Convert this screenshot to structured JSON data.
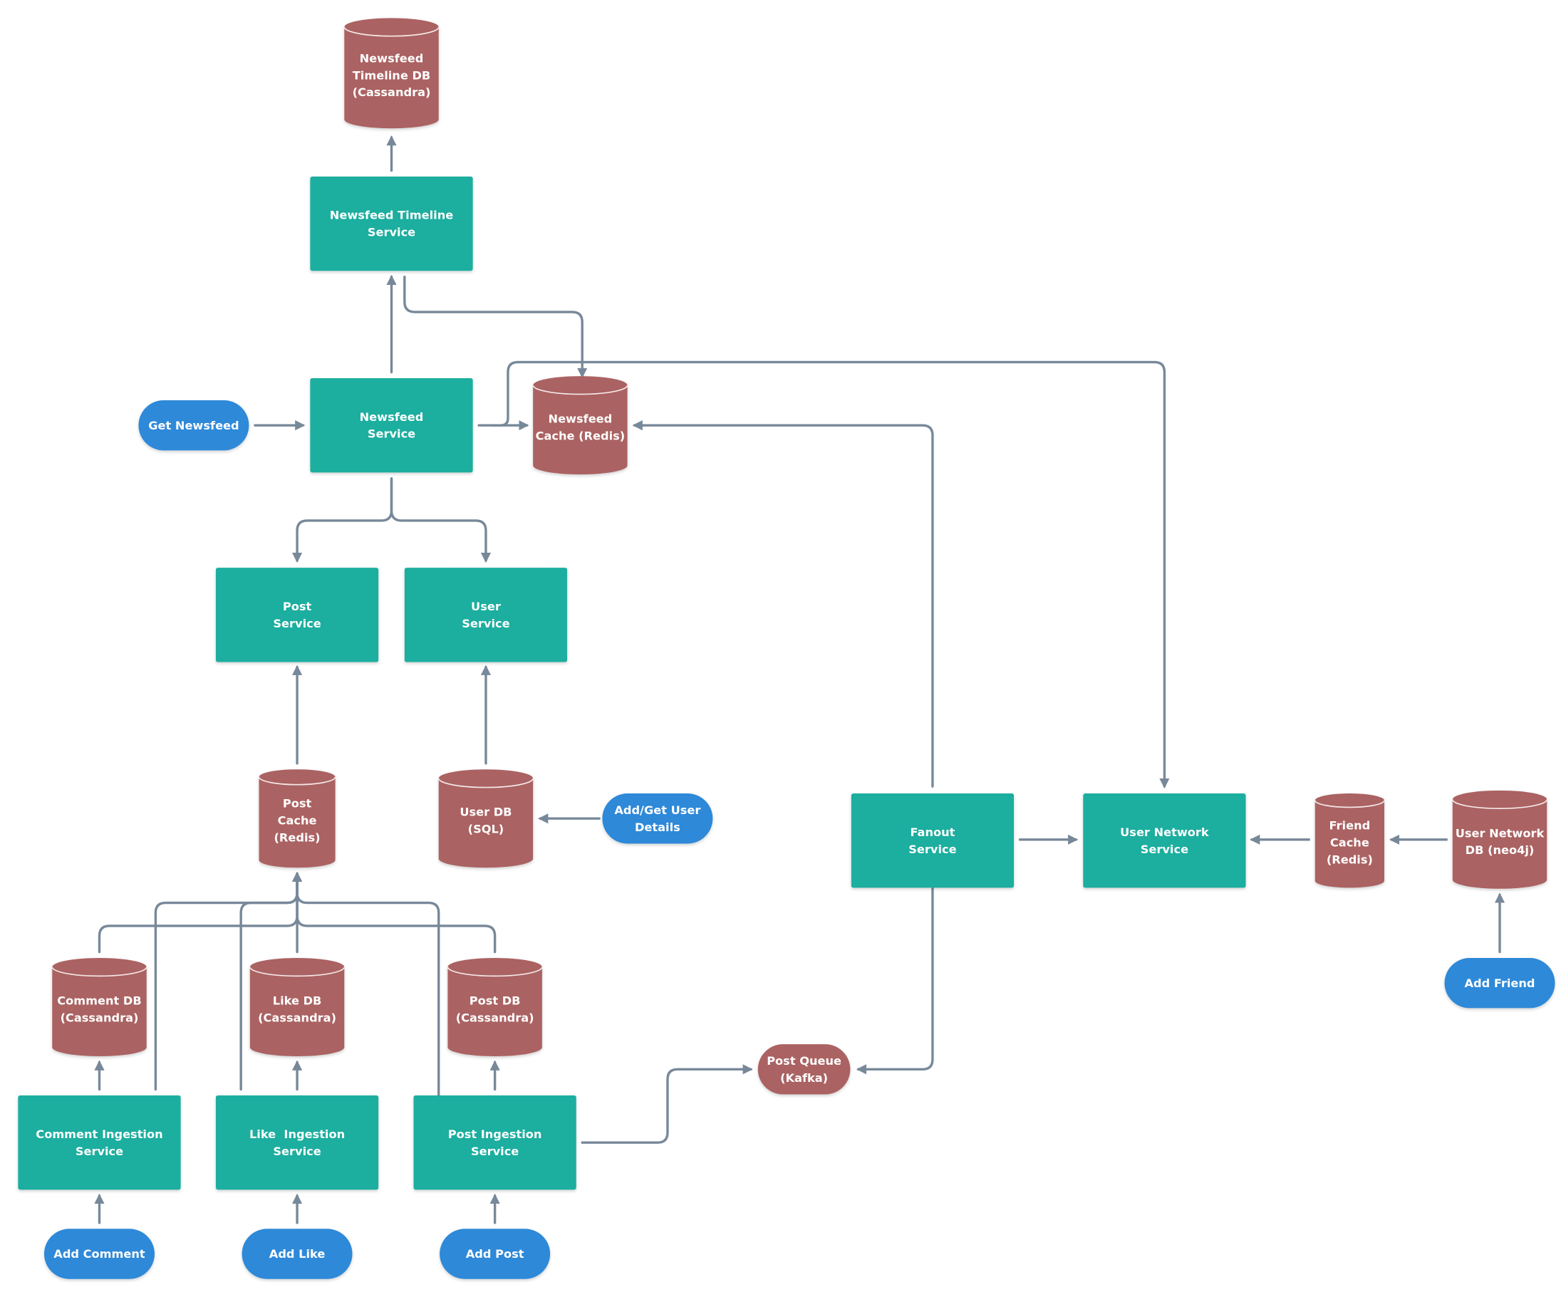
{
  "diagram": {
    "colors": {
      "service": "#1bae9f",
      "datastore": "#ab6262",
      "action": "#2d89d8",
      "connector": "#778899",
      "text": "#ffffff"
    },
    "nodes": {
      "timeline_db": {
        "kind": "database",
        "lines": [
          "Newsfeed",
          "Timeline DB",
          "(Cassandra)"
        ]
      },
      "timeline_service": {
        "kind": "service",
        "lines": [
          "Newsfeed Timeline",
          "Service"
        ]
      },
      "get_newsfeed": {
        "kind": "action",
        "lines": [
          "Get Newsfeed"
        ]
      },
      "newsfeed_service": {
        "kind": "service",
        "lines": [
          "Newsfeed",
          "Service"
        ]
      },
      "newsfeed_cache": {
        "kind": "database",
        "lines": [
          "Newsfeed",
          "Cache (Redis)"
        ]
      },
      "post_service": {
        "kind": "service",
        "lines": [
          "Post",
          "Service"
        ]
      },
      "user_service": {
        "kind": "service",
        "lines": [
          "User",
          "Service"
        ]
      },
      "post_cache": {
        "kind": "database",
        "lines": [
          "Post",
          "Cache",
          "(Redis)"
        ]
      },
      "user_db": {
        "kind": "database",
        "lines": [
          "User DB",
          "(SQL)"
        ]
      },
      "add_get_user": {
        "kind": "action",
        "lines": [
          "Add/Get User",
          "Details"
        ]
      },
      "comment_db": {
        "kind": "database",
        "lines": [
          "Comment DB",
          "(Cassandra)"
        ]
      },
      "like_db": {
        "kind": "database",
        "lines": [
          "Like DB",
          "(Cassandra)"
        ]
      },
      "post_db": {
        "kind": "database",
        "lines": [
          "Post DB",
          "(Cassandra)"
        ]
      },
      "comment_ingestion": {
        "kind": "service",
        "lines": [
          "Comment Ingestion",
          "Service"
        ]
      },
      "like_ingestion": {
        "kind": "service",
        "lines": [
          "Like  Ingestion",
          "Service"
        ]
      },
      "post_ingestion": {
        "kind": "service",
        "lines": [
          "Post Ingestion",
          "Service"
        ]
      },
      "add_comment": {
        "kind": "action",
        "lines": [
          "Add Comment"
        ]
      },
      "add_like": {
        "kind": "action",
        "lines": [
          "Add Like"
        ]
      },
      "add_post": {
        "kind": "action",
        "lines": [
          "Add Post"
        ]
      },
      "post_queue": {
        "kind": "queue",
        "lines": [
          "Post Queue",
          "(Kafka)"
        ]
      },
      "fanout_service": {
        "kind": "service",
        "lines": [
          "Fanout",
          "Service"
        ]
      },
      "user_network_service": {
        "kind": "service",
        "lines": [
          "User Network",
          "Service"
        ]
      },
      "friend_cache": {
        "kind": "database",
        "lines": [
          "Friend",
          "Cache",
          "(Redis)"
        ]
      },
      "user_network_db": {
        "kind": "database",
        "lines": [
          "User Network",
          "DB (neo4j)"
        ]
      },
      "add_friend": {
        "kind": "action",
        "lines": [
          "Add Friend"
        ]
      }
    },
    "edges": [
      {
        "from": "timeline_service",
        "to": "timeline_db"
      },
      {
        "from": "newsfeed_service",
        "to": "timeline_service"
      },
      {
        "from": "timeline_service",
        "to": "newsfeed_cache"
      },
      {
        "from": "get_newsfeed",
        "to": "newsfeed_service"
      },
      {
        "from": "newsfeed_service",
        "to": "newsfeed_cache"
      },
      {
        "from": "newsfeed_service",
        "to": "user_network_service"
      },
      {
        "from": "fanout_service",
        "to": "newsfeed_cache"
      },
      {
        "from": "newsfeed_service",
        "to": "post_service"
      },
      {
        "from": "newsfeed_service",
        "to": "user_service"
      },
      {
        "from": "post_cache",
        "to": "post_service"
      },
      {
        "from": "user_db",
        "to": "user_service"
      },
      {
        "from": "add_get_user",
        "to": "user_db"
      },
      {
        "from": "comment_db",
        "to": "post_cache"
      },
      {
        "from": "like_db",
        "to": "post_cache"
      },
      {
        "from": "post_db",
        "to": "post_cache"
      },
      {
        "from": "comment_ingestion",
        "to": "post_cache"
      },
      {
        "from": "like_ingestion",
        "to": "post_cache"
      },
      {
        "from": "post_ingestion",
        "to": "post_cache"
      },
      {
        "from": "comment_ingestion",
        "to": "comment_db"
      },
      {
        "from": "like_ingestion",
        "to": "like_db"
      },
      {
        "from": "post_ingestion",
        "to": "post_db"
      },
      {
        "from": "add_comment",
        "to": "comment_ingestion"
      },
      {
        "from": "add_like",
        "to": "like_ingestion"
      },
      {
        "from": "add_post",
        "to": "post_ingestion"
      },
      {
        "from": "post_ingestion",
        "to": "post_queue"
      },
      {
        "from": "fanout_service",
        "to": "post_queue"
      },
      {
        "from": "fanout_service",
        "to": "user_network_service"
      },
      {
        "from": "friend_cache",
        "to": "user_network_service"
      },
      {
        "from": "user_network_db",
        "to": "friend_cache"
      },
      {
        "from": "add_friend",
        "to": "user_network_db"
      }
    ]
  }
}
